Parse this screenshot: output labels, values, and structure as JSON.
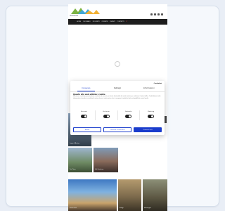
{
  "site": {
    "logo_text": "dolomiti",
    "nav_items": [
      "HOME",
      "CHI SIAMO",
      "DOLOMITI",
      "OFFERTE",
      "EVENTI",
      "CONTATTI",
      "IT"
    ],
    "thumbs": [
      {
        "caption": "Lago di Braies"
      },
      {
        "caption": "Tre Cime"
      },
      {
        "caption": "Val Gardena"
      },
      {
        "caption": "Escursioni"
      },
      {
        "caption": "Rifugi"
      },
      {
        "caption": "Montagna"
      }
    ]
  },
  "cookie": {
    "brand": "Cookiebot",
    "tabs": [
      "Consenso",
      "Dettagli",
      "Informazioni"
    ],
    "title": "Questo sito web utilizza i cookie",
    "body": "Utilizziamo i cookie per personalizzare contenuti ed annunci, per fornire funzionalità dei social media e per analizzare il nostro traffico. Condividiamo inoltre informazioni sul modo in cui utilizza il nostro sito con i nostri partner che si occupano di analisi dei dati web, pubblicità e social media.",
    "toggles": [
      "Necessari",
      "Preferenze",
      "Statistiche",
      "Marketing"
    ],
    "buttons": {
      "deny": "Rifiuta",
      "allow_selection": "Consenti la selezione",
      "allow_all": "Consenti tutti"
    }
  },
  "colors": {
    "accent": "#1a3ccc",
    "navbar": "#1d1d1d"
  }
}
